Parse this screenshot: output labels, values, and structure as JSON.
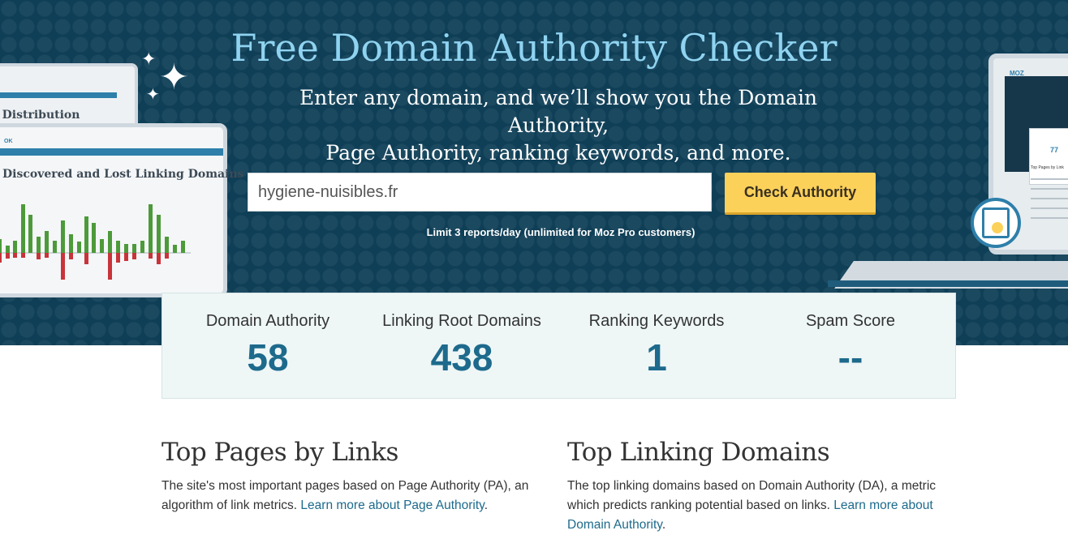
{
  "hero": {
    "title": "Free Domain Authority Checker",
    "subtitle_line1": "Enter any domain, and we’ll show you the Domain Authority,",
    "subtitle_line2": "Page Authority, ranking keywords, and more.",
    "domain_input_value": "hygiene-nuisibles.fr",
    "check_button_label": "Check Authority",
    "limit_note": "Limit 3 reports/day (unlimited for Moz Pro customers)"
  },
  "illustration": {
    "back_card_title": "g Distribution",
    "front_card_tag": "OK",
    "front_card_title": "Discovered and Lost Linking Domains",
    "laptop_brand": "MOZ",
    "laptop_value": "77",
    "laptop_caption": "Top Pages by Link"
  },
  "stats": [
    {
      "label": "Domain Authority",
      "value": "58"
    },
    {
      "label": "Linking Root Domains",
      "value": "438"
    },
    {
      "label": "Ranking Keywords",
      "value": "1"
    },
    {
      "label": "Spam Score",
      "value": "--"
    }
  ],
  "sections": {
    "top_pages": {
      "title": "Top Pages by Links",
      "text": "The site's most important pages based on Page Authority (PA), an algorithm of link metrics.",
      "link": "Learn more about Page Authority",
      "suffix": "."
    },
    "top_domains": {
      "title": "Top Linking Domains",
      "text": "The top linking domains based on Domain Authority (DA), a metric which predicts ranking potential based on links.",
      "link": "Learn more about Domain Authority",
      "suffix": "."
    }
  },
  "colors": {
    "hero_bg": "#0f3f57",
    "title_blue": "#8fd3f0",
    "button_yellow": "#fcd15a",
    "stat_blue": "#1d6a8c",
    "link_blue": "#1d6a8c"
  }
}
